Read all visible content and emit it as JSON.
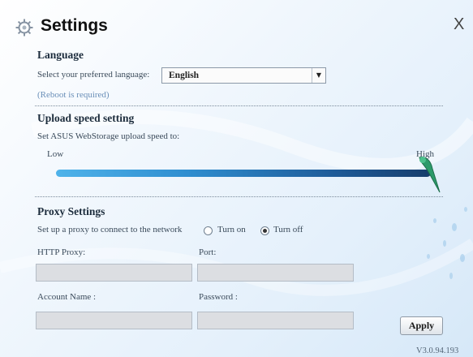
{
  "header": {
    "title": "Settings",
    "close_label": "X"
  },
  "language": {
    "heading": "Language",
    "prompt": "Select your preferred language:",
    "selected": "English",
    "note": "(Reboot is required)"
  },
  "upload": {
    "heading": "Upload speed setting",
    "prompt": "Set ASUS WebStorage upload speed to:",
    "low_label": "Low",
    "high_label": "High",
    "speed_level_fraction": 1.0
  },
  "proxy": {
    "heading": "Proxy Settings",
    "prompt": "Set up a proxy to connect to the network",
    "options": [
      {
        "label": "Turn on",
        "selected": false
      },
      {
        "label": "Turn off",
        "selected": true
      }
    ],
    "http_proxy_label": "HTTP Proxy:",
    "http_proxy_value": "",
    "port_label": "Port:",
    "port_value": "",
    "account_label": "Account Name :",
    "account_value": "",
    "password_label": "Password :",
    "password_value": ""
  },
  "footer": {
    "apply_label": "Apply",
    "version": "V3.0.94.193"
  },
  "colors": {
    "accent": "#1e5a97",
    "note": "#6a8fb8",
    "handle": "#2c9a6a"
  },
  "icons": {
    "title_icon": "gear-icon",
    "close_icon": "close-icon",
    "dropdown_icon": "chevron-down-icon"
  }
}
